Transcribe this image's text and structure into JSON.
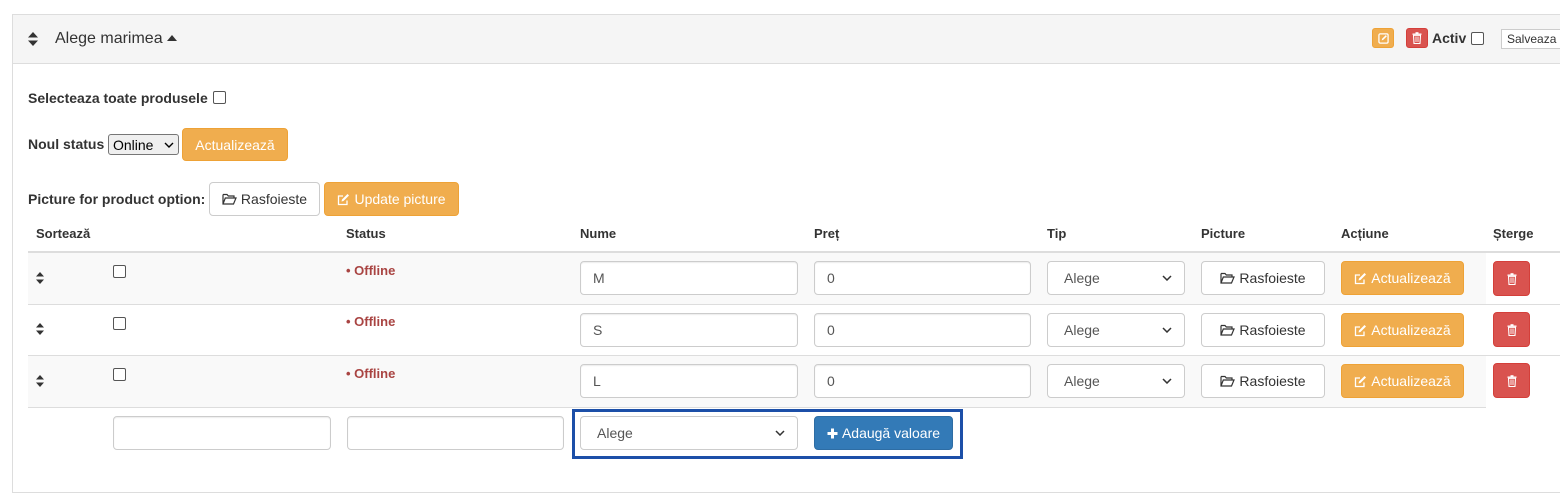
{
  "header": {
    "title": "Alege marimea",
    "active_label": "Activ",
    "save_label": "Salveaza"
  },
  "bulk": {
    "select_all_label": "Selecteaza toate produsele",
    "new_status_label": "Noul status",
    "status_value": "Online",
    "update_label": "Actualizează"
  },
  "picture_option": {
    "label": "Picture for product option:",
    "browse_label": "Rasfoieste",
    "update_picture_label": "Update picture"
  },
  "table": {
    "headers": {
      "sort": "Sortează",
      "status": "Status",
      "name": "Nume",
      "price": "Preț",
      "type": "Tip",
      "picture": "Picture",
      "action": "Acțiune",
      "delete": "Șterge"
    },
    "rows": [
      {
        "status": "• Offline",
        "name": "M",
        "price": "0",
        "type": "Alege",
        "browse": "Rasfoieste",
        "update": "Actualizează"
      },
      {
        "status": "• Offline",
        "name": "S",
        "price": "0",
        "type": "Alege",
        "browse": "Rasfoieste",
        "update": "Actualizează"
      },
      {
        "status": "• Offline",
        "name": "L",
        "price": "0",
        "type": "Alege",
        "browse": "Rasfoieste",
        "update": "Actualizează"
      }
    ]
  },
  "add_row": {
    "type_value": "Alege",
    "add_label": "Adaugă valoare"
  },
  "icons": {
    "sort": "sort-icon",
    "edit": "edit-icon",
    "trash": "trash-icon",
    "folder": "folder-open-icon",
    "plus": "plus-icon",
    "chevron": "chevron-down-icon"
  },
  "colors": {
    "warning": "#f0ad4e",
    "danger": "#d9534f",
    "primary": "#337ab7",
    "offline": "#a94442",
    "highlight": "#1c4fa8"
  }
}
